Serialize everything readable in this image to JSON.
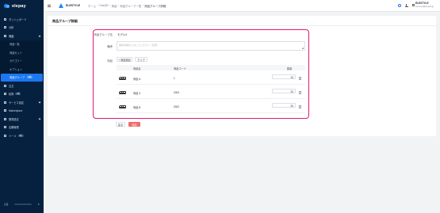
{
  "sidebar": {
    "logo": "elepay",
    "items": [
      {
        "label": "ダッシュボード",
        "icon": "dashboard-icon"
      },
      {
        "label": "分析",
        "icon": "chart-icon"
      },
      {
        "label": "商品",
        "icon": "tag-icon"
      },
      {
        "label": "注文",
        "icon": "cart-icon"
      },
      {
        "label": "精算",
        "icon": "calculator-icon",
        "tag": "β版"
      },
      {
        "label": "サービス設定",
        "icon": "settings-icon"
      },
      {
        "label": "Marketplace",
        "icon": "grid-icon"
      },
      {
        "label": "開発設定",
        "icon": "code-icon"
      },
      {
        "label": "店舗管理",
        "icon": "store-icon"
      },
      {
        "label": "ツール",
        "icon": "tool-icon",
        "tag": "β版"
      }
    ],
    "product_sub": [
      {
        "label": "商品一覧"
      },
      {
        "label": "商品セット"
      },
      {
        "label": "カテゴリー"
      },
      {
        "label": "オプション"
      },
      {
        "label": "商品グループ",
        "tag": "β版"
      }
    ],
    "footer_label": "店舗"
  },
  "header": {
    "brand": "ELESTYLE",
    "breadcrumbs": [
      "ホーム",
      "OneQR",
      "商品",
      "商品グループ一覧",
      "商品グループ詳細"
    ],
    "user_name": "ELESTYLE",
    "user_email": "someone@elestyle.jp"
  },
  "main": {
    "title": "商品グループ詳細",
    "form": {
      "group_name_label": "商品グループ名",
      "group_name_value": "モデルX",
      "memo_label": "備考",
      "memo_placeholder": "備考内容を入力してください（任意）",
      "products_label": "商品",
      "add_button": "+ 商品追加",
      "clear_button": "クリア",
      "columns": [
        "商品名",
        "商品コード",
        "数量"
      ],
      "rows": [
        {
          "name": "商品 A",
          "code": "1",
          "qty": "10"
        },
        {
          "name": "商品 X",
          "code": "0004",
          "qty": "20"
        },
        {
          "name": "商品 B",
          "code": "0002",
          "qty": "20"
        }
      ]
    },
    "back_button": "戻る",
    "save_button": "保存"
  },
  "colors": {
    "sidebar_bg": "#06213f",
    "active": "#1b78f2",
    "highlight_frame": "#e0187a",
    "save": "#f06b6b"
  }
}
